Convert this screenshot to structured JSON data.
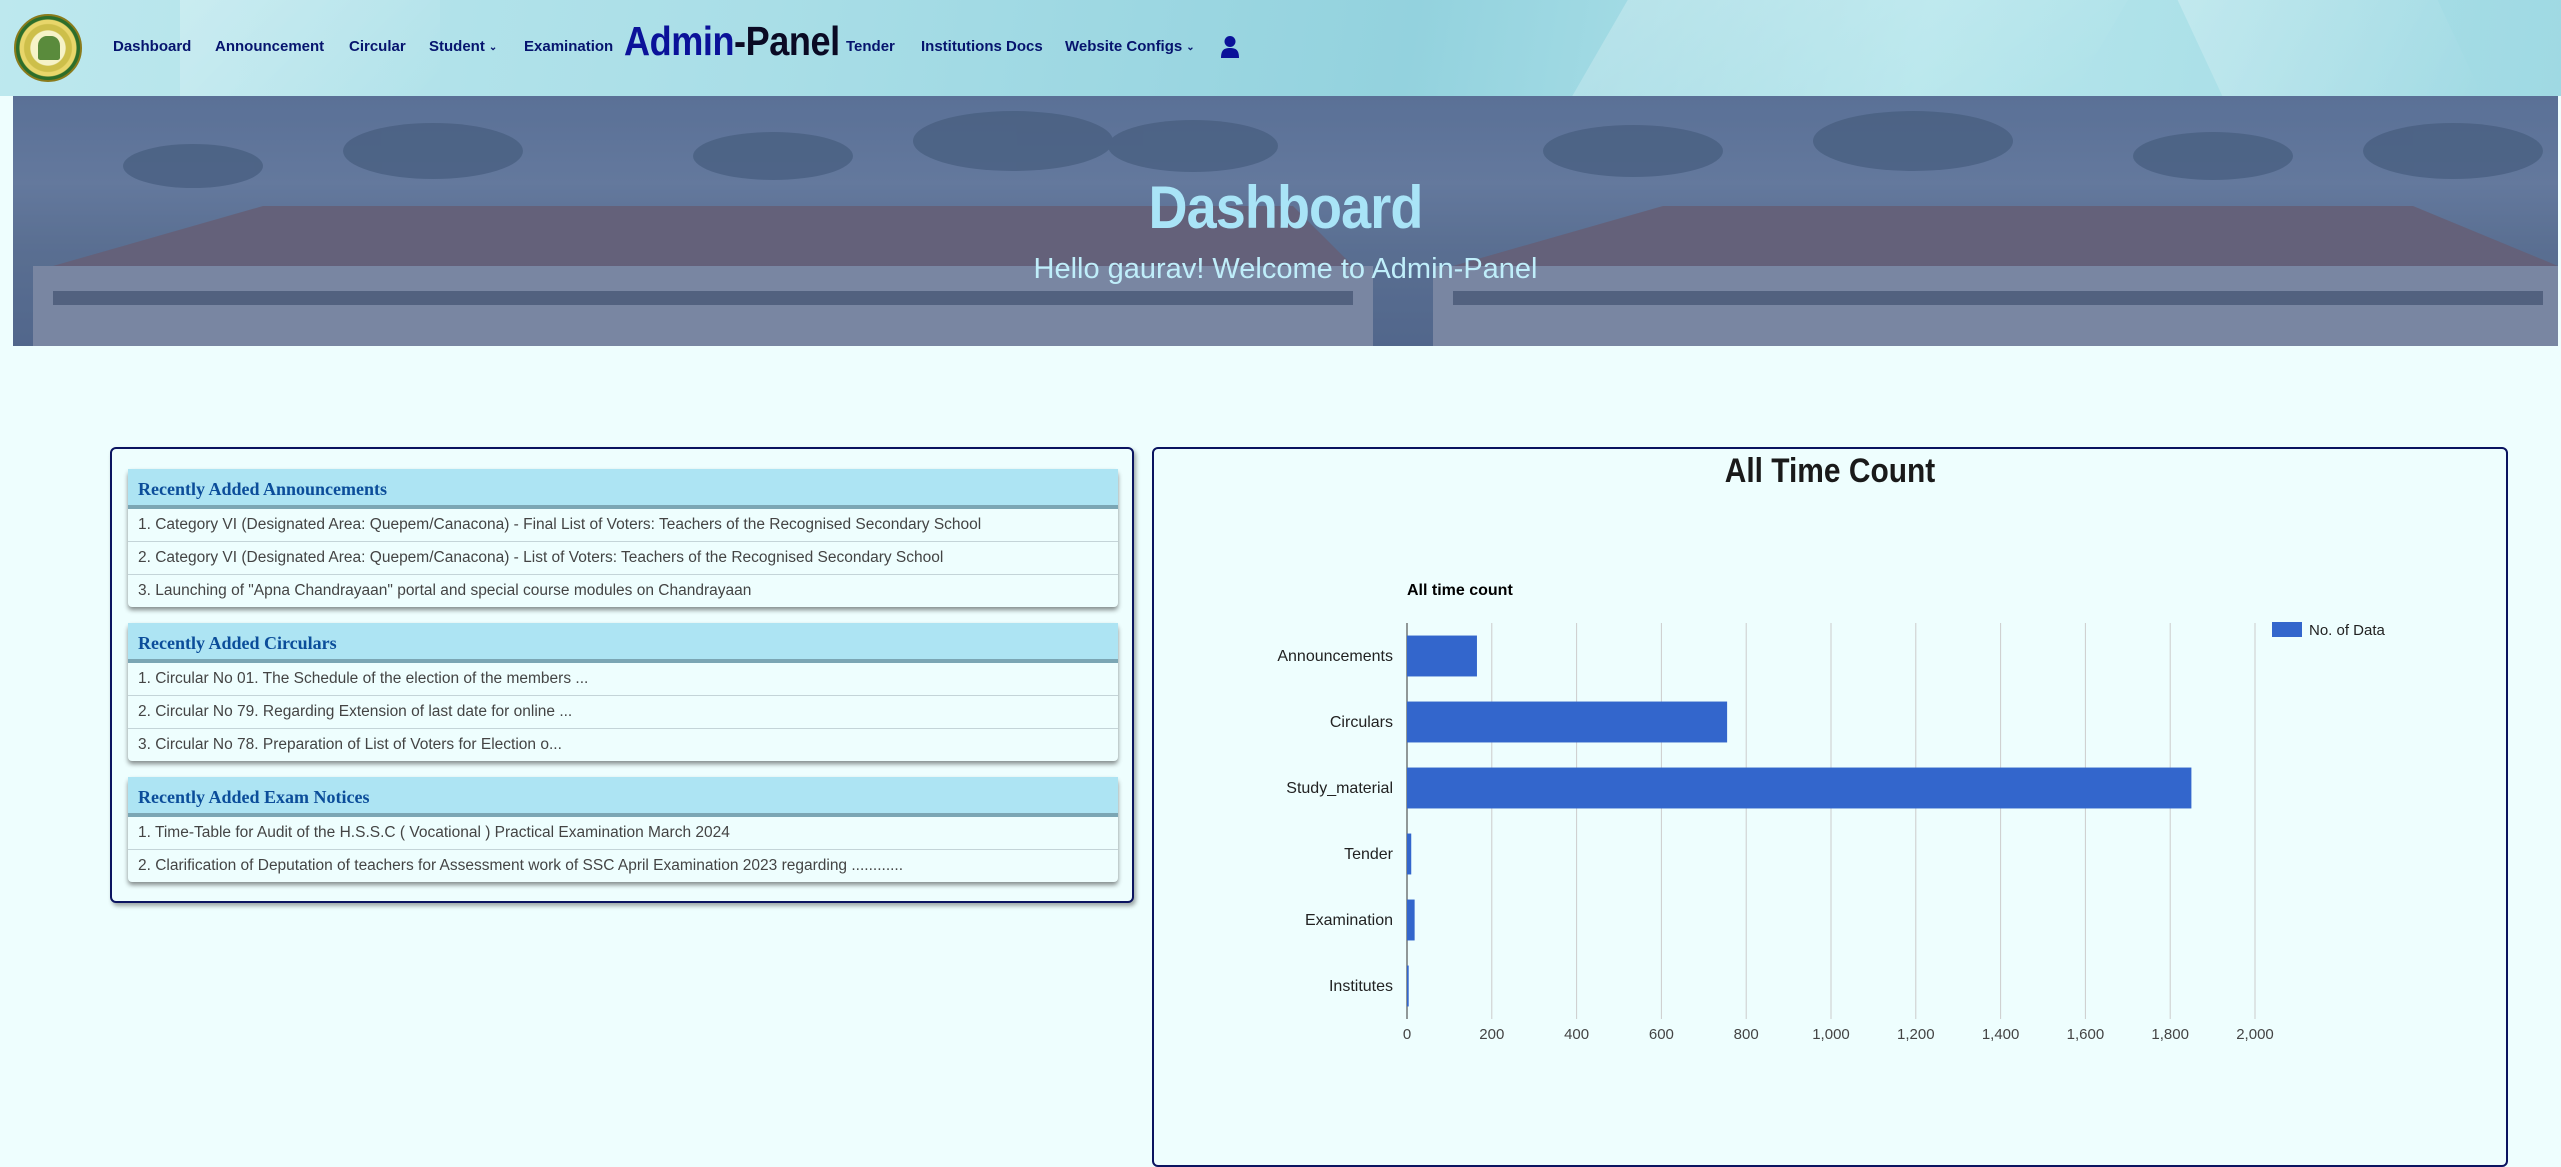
{
  "nav": {
    "items": [
      {
        "id": "dashboard",
        "label": "Dashboard"
      },
      {
        "id": "announcement",
        "label": "Announcement"
      },
      {
        "id": "circular",
        "label": "Circular"
      },
      {
        "id": "student",
        "label": "Student",
        "chevron": "chevron-down-icon"
      },
      {
        "id": "examination",
        "label": "Examination"
      },
      {
        "id": "tender",
        "label": "Tender"
      },
      {
        "id": "institutions-docs",
        "label": "Institutions Docs"
      },
      {
        "id": "website-configs",
        "label": "Website Configs",
        "chevron": "chevron-down-icon"
      }
    ],
    "brand_part1": "Admin",
    "brand_part2": "-Panel",
    "user_icon": "user-icon",
    "logo_icon": "emblem-logo"
  },
  "hero": {
    "title": "Dashboard",
    "subtitle": "Hello gaurav! Welcome to Admin-Panel"
  },
  "sections": [
    {
      "title": "Recently Added Announcements",
      "items": [
        "1. Category VI (Designated Area: Quepem/Canacona) - Final List of Voters: Teachers of the Recognised Secondary School",
        "2. Category VI (Designated Area: Quepem/Canacona) - List of Voters: Teachers of the Recognised Secondary School",
        "3. Launching of \"Apna Chandrayaan\" portal and special course modules on Chandrayaan"
      ]
    },
    {
      "title": "Recently Added Circulars",
      "items": [
        "1. Circular No 01. The Schedule of the election of the members ...",
        "2. Circular No 79. Regarding Extension of last date for online ...",
        "3. Circular No 78. Preparation of List of Voters for Election o..."
      ]
    },
    {
      "title": "Recently Added Exam Notices",
      "items": [
        "1. Time-Table for Audit of the H.S.S.C ( Vocational ) Practical Examination March 2024",
        "2. Clarification of Deputation of teachers for Assessment work of SSC April Examination 2023 regarding ............"
      ]
    }
  ],
  "colors": {
    "nav_text": "#06146e",
    "brand_blue": "#0b1299",
    "bar": "#3366cc",
    "section_header_bg": "#ade4f3",
    "section_header_text": "#0b4d9a"
  },
  "chart_heading": "All Time Count",
  "chart_data": {
    "type": "bar",
    "orientation": "horizontal",
    "title": "All time count",
    "categories": [
      "Announcements",
      "Circulars",
      "Study_material",
      "Tender",
      "Examination",
      "Institutes"
    ],
    "series": [
      {
        "name": "No. of Data",
        "values": [
          165,
          755,
          1850,
          10,
          18,
          4
        ]
      }
    ],
    "xlim": [
      0,
      2000
    ],
    "xticks": [
      0,
      200,
      400,
      600,
      800,
      1000,
      1200,
      1400,
      1600,
      1800,
      2000
    ],
    "xtick_labels": [
      "0",
      "200",
      "400",
      "600",
      "800",
      "1,000",
      "1,200",
      "1,400",
      "1,600",
      "1,800",
      "2,000"
    ],
    "grid": true,
    "legend": "top-right"
  }
}
